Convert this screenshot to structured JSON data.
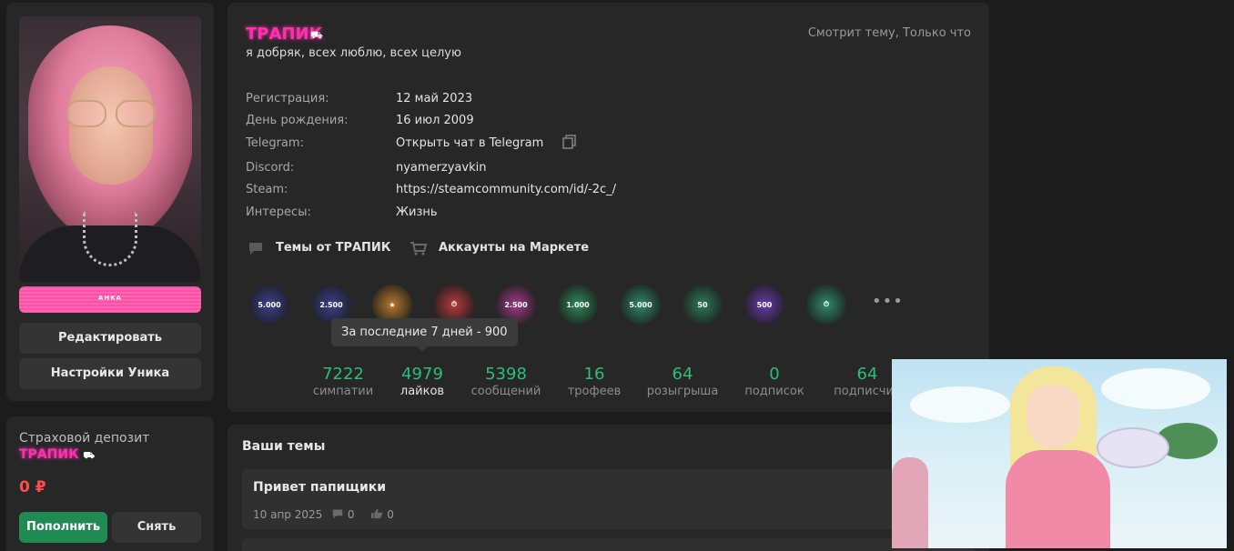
{
  "sidebar": {
    "avatar_alt": "avatar",
    "nick_banner": "ᴬᴴᴷᴬ",
    "edit_label": "Редактировать",
    "unique_settings_label": "Настройки Уника"
  },
  "deposit": {
    "title": "Страховой депозит",
    "nick": "ТРАПИК",
    "value": "0 ₽",
    "topup_label": "Пополнить",
    "withdraw_label": "Снять"
  },
  "profile": {
    "nick": "ТРАПИК",
    "status": "я добряк, всех люблю, всех целую",
    "viewing": "Смотрит тему, Только что",
    "info": [
      {
        "key": "Регистрация:",
        "value": "12 май 2023"
      },
      {
        "key": "День рождения:",
        "value": "16 июл 2009"
      },
      {
        "key": "Telegram:",
        "value": "Открыть чат в Telegram"
      },
      {
        "key": "Discord:",
        "value": "nyamerzyavkin"
      },
      {
        "key": "Steam:",
        "value": "https://steamcommunity.com/id/-2c_/"
      },
      {
        "key": "Интересы:",
        "value": "Жизнь"
      }
    ],
    "links": {
      "topics": "Темы от ТРАПИК",
      "market": "Аккаунты на Маркете"
    },
    "badges": [
      {
        "label": "5.000",
        "color": "#3a3f8f"
      },
      {
        "label": "2.500",
        "color": "#3a3f8f"
      },
      {
        "label": "★",
        "color": "#b8792a"
      },
      {
        "label": "⏱",
        "color": "#b83a3a"
      },
      {
        "label": "2.500",
        "color": "#a23a8a"
      },
      {
        "label": "1.000",
        "color": "#2e8a5a"
      },
      {
        "label": "5.000",
        "color": "#2e8a6a"
      },
      {
        "label": "50",
        "color": "#2e7a5a"
      },
      {
        "label": "500",
        "color": "#6a3aa8"
      },
      {
        "label": "⏱",
        "color": "#2e8a6a"
      }
    ],
    "more_label": "•••",
    "tooltip": "За последние 7 дней - 900",
    "stats": [
      {
        "num": "7222",
        "label": "симпатии"
      },
      {
        "num": "4979",
        "label": "лайков"
      },
      {
        "num": "5398",
        "label": "сообщений"
      },
      {
        "num": "16",
        "label": "трофеев"
      },
      {
        "num": "64",
        "label": "розыгрыша"
      },
      {
        "num": "0",
        "label": "подписок"
      },
      {
        "num": "64",
        "label": "подписчик"
      }
    ]
  },
  "topics": {
    "title": "Ваши темы",
    "items": [
      {
        "name": "Привет папищики",
        "date": "10 апр 2025",
        "comments": "0",
        "likes": "0"
      }
    ]
  }
}
